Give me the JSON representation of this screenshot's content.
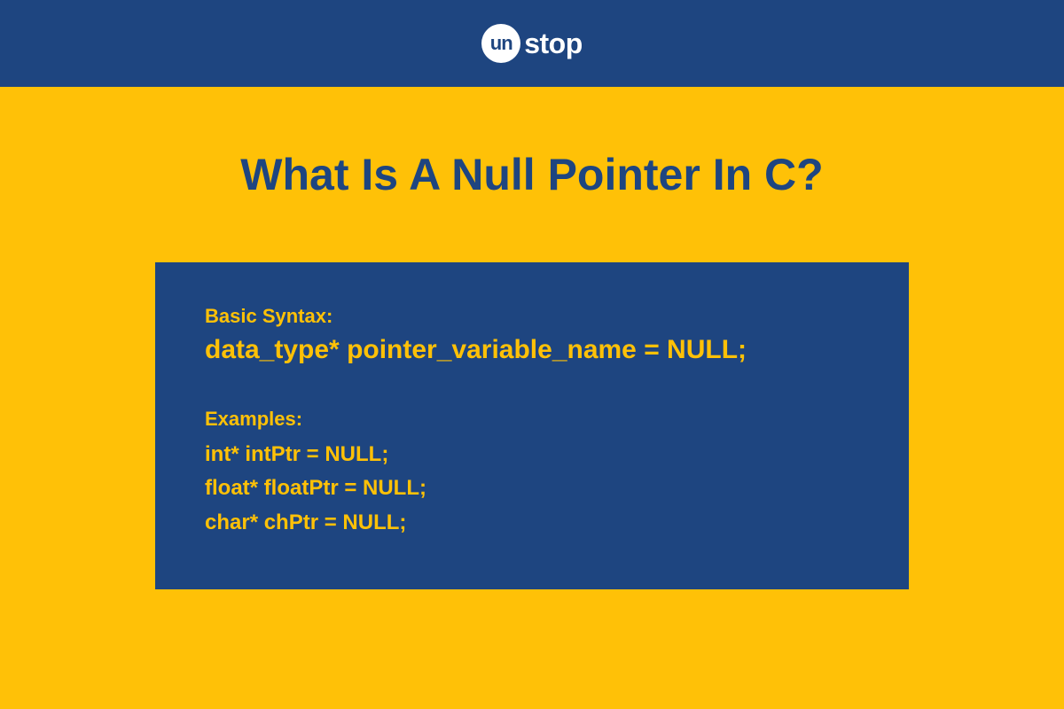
{
  "header": {
    "logo": {
      "circle_text": "un",
      "brand_text": "stop"
    }
  },
  "main": {
    "title": "What Is A Null Pointer In C?",
    "code_box": {
      "syntax_label": "Basic Syntax:",
      "syntax_code": "data_type* pointer_variable_name = NULL;",
      "examples_label": "Examples:",
      "examples": [
        "int* intPtr = NULL;",
        "float* floatPtr = NULL;",
        "char* chPtr = NULL;"
      ]
    }
  },
  "colors": {
    "blue": "#1e4580",
    "yellow": "#ffc107",
    "white": "#ffffff"
  }
}
